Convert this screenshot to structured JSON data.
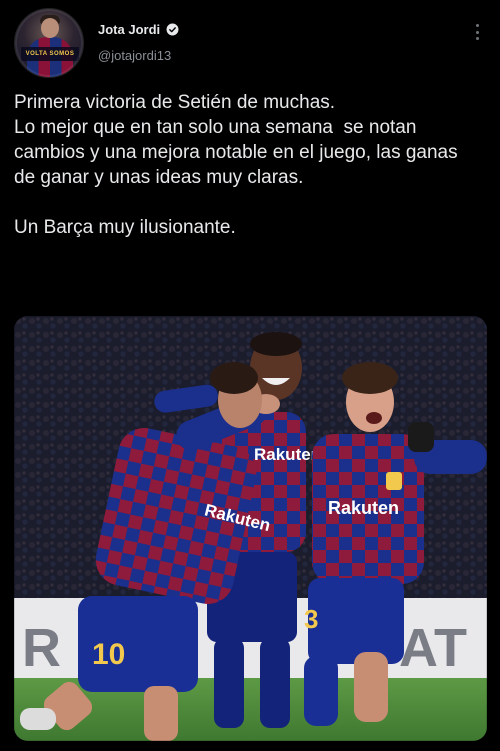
{
  "author": {
    "display_name": "Jota Jordi",
    "handle": "@jotajordi13",
    "verified": true,
    "avatar_caption": "VOLTA SOMOS"
  },
  "tweet": {
    "paragraphs": [
      "Primera victoria de Setién de muchas.\nLo mejor que en tan solo una semana  se notan cambios y una mejora notable en el juego, las ganas de ganar y unas ideas muy claras.",
      "Un Barça muy ilusionante."
    ]
  },
  "media": {
    "sponsor_left": "Rakuten",
    "sponsor_center": "Rakuten",
    "sponsor_right": "Rakuten",
    "number_left": "10",
    "number_right": "3",
    "board_left": "R",
    "board_right": "AT"
  },
  "colors": {
    "background": "#000000",
    "text": "#e7e9ea",
    "muted": "#8b9096",
    "barca_blue": "#1b2f8c",
    "barca_red": "#8e1a3c",
    "pitch": "#4f8a3a"
  },
  "icons": [
    "verified-icon",
    "more-icon"
  ]
}
